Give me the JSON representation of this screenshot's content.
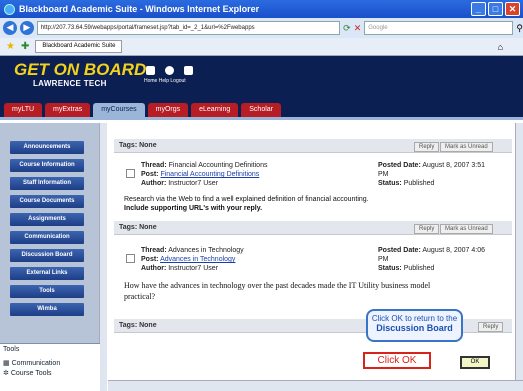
{
  "window": {
    "title": "Blackboard Academic Suite - Windows Internet Explorer"
  },
  "browser": {
    "url": "http://207.73.64.59/webapps/portal/frameset.jsp?tab_id=_2_1&url=%2Fwebapps",
    "search_placeholder": "Google",
    "tab_title": "Blackboard Academic Suite"
  },
  "header": {
    "logo_line1": "GET ON BOARD",
    "logo_line2": "LAWRENCE TECH",
    "links": "Home  Help  Logout"
  },
  "tabs": [
    {
      "label": "myLTU"
    },
    {
      "label": "myExtras"
    },
    {
      "label": "myCourses"
    },
    {
      "label": "myOrgs"
    },
    {
      "label": "eLearning"
    },
    {
      "label": "Scholar"
    }
  ],
  "sidebar": {
    "items": [
      {
        "label": "Announcements"
      },
      {
        "label": "Course Information"
      },
      {
        "label": "Staff Information"
      },
      {
        "label": "Course Documents"
      },
      {
        "label": "Assignments"
      },
      {
        "label": "Communication"
      },
      {
        "label": "Discussion Board"
      },
      {
        "label": "External Links"
      },
      {
        "label": "Tools"
      },
      {
        "label": "Wimba"
      }
    ],
    "tools_title": "Tools",
    "tools_items": [
      {
        "label": "Communication"
      },
      {
        "label": "Course Tools"
      }
    ]
  },
  "content": {
    "tags_label": "Tags: None",
    "reply_label": "Reply",
    "mark_label": "Mark as Unread",
    "threads": [
      {
        "thread_label": "Thread:",
        "thread_title": "Financial Accounting Definitions",
        "post_label": "Post:",
        "post_title": "Financial Accounting Definitions",
        "author_label": "Author:",
        "author": "Instructor7 User",
        "date_label": "Posted Date:",
        "date": "August 8, 2007 3:51",
        "date_cont": "PM",
        "status_label": "Status:",
        "status": "Published",
        "body_line1": "Research via the Web to find a well explained definition of financial accounting.",
        "body_line2": "Include supporting URL's with your reply."
      },
      {
        "thread_label": "Thread:",
        "thread_title": "Advances in Technology",
        "post_label": "Post:",
        "post_title": "Advances in Technology",
        "author_label": "Author:",
        "author": "Instructor7 User",
        "date_label": "Posted Date:",
        "date": "August 8, 2007 4:06",
        "date_cont": "PM",
        "status_label": "Status:",
        "status": "Published",
        "body_line1": "How have the advances in technology over the past decades made the IT Utility business model",
        "body_line2": "practical?"
      }
    ]
  },
  "callout": {
    "line1": "Click OK to return to the",
    "line2": "Discussion Board"
  },
  "ok_box_label": "Click OK",
  "ok_button_label": "OK"
}
